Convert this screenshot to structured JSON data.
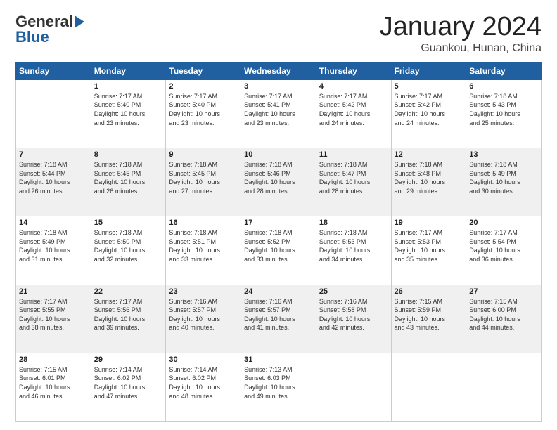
{
  "header": {
    "logo_general": "General",
    "logo_blue": "Blue",
    "month_year": "January 2024",
    "location": "Guankou, Hunan, China"
  },
  "calendar": {
    "days_of_week": [
      "Sunday",
      "Monday",
      "Tuesday",
      "Wednesday",
      "Thursday",
      "Friday",
      "Saturday"
    ],
    "weeks": [
      [
        {
          "day": "",
          "content": ""
        },
        {
          "day": "1",
          "content": "Sunrise: 7:17 AM\nSunset: 5:40 PM\nDaylight: 10 hours\nand 23 minutes."
        },
        {
          "day": "2",
          "content": "Sunrise: 7:17 AM\nSunset: 5:40 PM\nDaylight: 10 hours\nand 23 minutes."
        },
        {
          "day": "3",
          "content": "Sunrise: 7:17 AM\nSunset: 5:41 PM\nDaylight: 10 hours\nand 23 minutes."
        },
        {
          "day": "4",
          "content": "Sunrise: 7:17 AM\nSunset: 5:42 PM\nDaylight: 10 hours\nand 24 minutes."
        },
        {
          "day": "5",
          "content": "Sunrise: 7:17 AM\nSunset: 5:42 PM\nDaylight: 10 hours\nand 24 minutes."
        },
        {
          "day": "6",
          "content": "Sunrise: 7:18 AM\nSunset: 5:43 PM\nDaylight: 10 hours\nand 25 minutes."
        }
      ],
      [
        {
          "day": "7",
          "content": "Sunrise: 7:18 AM\nSunset: 5:44 PM\nDaylight: 10 hours\nand 26 minutes."
        },
        {
          "day": "8",
          "content": "Sunrise: 7:18 AM\nSunset: 5:45 PM\nDaylight: 10 hours\nand 26 minutes."
        },
        {
          "day": "9",
          "content": "Sunrise: 7:18 AM\nSunset: 5:45 PM\nDaylight: 10 hours\nand 27 minutes."
        },
        {
          "day": "10",
          "content": "Sunrise: 7:18 AM\nSunset: 5:46 PM\nDaylight: 10 hours\nand 28 minutes."
        },
        {
          "day": "11",
          "content": "Sunrise: 7:18 AM\nSunset: 5:47 PM\nDaylight: 10 hours\nand 28 minutes."
        },
        {
          "day": "12",
          "content": "Sunrise: 7:18 AM\nSunset: 5:48 PM\nDaylight: 10 hours\nand 29 minutes."
        },
        {
          "day": "13",
          "content": "Sunrise: 7:18 AM\nSunset: 5:49 PM\nDaylight: 10 hours\nand 30 minutes."
        }
      ],
      [
        {
          "day": "14",
          "content": "Sunrise: 7:18 AM\nSunset: 5:49 PM\nDaylight: 10 hours\nand 31 minutes."
        },
        {
          "day": "15",
          "content": "Sunrise: 7:18 AM\nSunset: 5:50 PM\nDaylight: 10 hours\nand 32 minutes."
        },
        {
          "day": "16",
          "content": "Sunrise: 7:18 AM\nSunset: 5:51 PM\nDaylight: 10 hours\nand 33 minutes."
        },
        {
          "day": "17",
          "content": "Sunrise: 7:18 AM\nSunset: 5:52 PM\nDaylight: 10 hours\nand 33 minutes."
        },
        {
          "day": "18",
          "content": "Sunrise: 7:18 AM\nSunset: 5:53 PM\nDaylight: 10 hours\nand 34 minutes."
        },
        {
          "day": "19",
          "content": "Sunrise: 7:17 AM\nSunset: 5:53 PM\nDaylight: 10 hours\nand 35 minutes."
        },
        {
          "day": "20",
          "content": "Sunrise: 7:17 AM\nSunset: 5:54 PM\nDaylight: 10 hours\nand 36 minutes."
        }
      ],
      [
        {
          "day": "21",
          "content": "Sunrise: 7:17 AM\nSunset: 5:55 PM\nDaylight: 10 hours\nand 38 minutes."
        },
        {
          "day": "22",
          "content": "Sunrise: 7:17 AM\nSunset: 5:56 PM\nDaylight: 10 hours\nand 39 minutes."
        },
        {
          "day": "23",
          "content": "Sunrise: 7:16 AM\nSunset: 5:57 PM\nDaylight: 10 hours\nand 40 minutes."
        },
        {
          "day": "24",
          "content": "Sunrise: 7:16 AM\nSunset: 5:57 PM\nDaylight: 10 hours\nand 41 minutes."
        },
        {
          "day": "25",
          "content": "Sunrise: 7:16 AM\nSunset: 5:58 PM\nDaylight: 10 hours\nand 42 minutes."
        },
        {
          "day": "26",
          "content": "Sunrise: 7:15 AM\nSunset: 5:59 PM\nDaylight: 10 hours\nand 43 minutes."
        },
        {
          "day": "27",
          "content": "Sunrise: 7:15 AM\nSunset: 6:00 PM\nDaylight: 10 hours\nand 44 minutes."
        }
      ],
      [
        {
          "day": "28",
          "content": "Sunrise: 7:15 AM\nSunset: 6:01 PM\nDaylight: 10 hours\nand 46 minutes."
        },
        {
          "day": "29",
          "content": "Sunrise: 7:14 AM\nSunset: 6:02 PM\nDaylight: 10 hours\nand 47 minutes."
        },
        {
          "day": "30",
          "content": "Sunrise: 7:14 AM\nSunset: 6:02 PM\nDaylight: 10 hours\nand 48 minutes."
        },
        {
          "day": "31",
          "content": "Sunrise: 7:13 AM\nSunset: 6:03 PM\nDaylight: 10 hours\nand 49 minutes."
        },
        {
          "day": "",
          "content": ""
        },
        {
          "day": "",
          "content": ""
        },
        {
          "day": "",
          "content": ""
        }
      ]
    ]
  }
}
